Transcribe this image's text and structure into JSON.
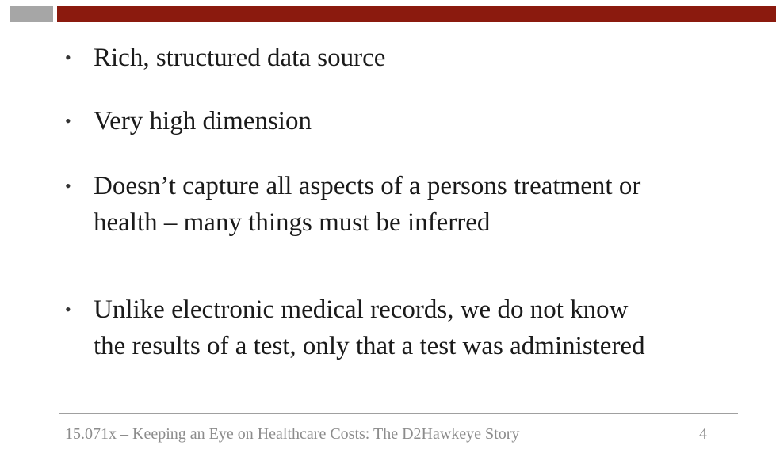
{
  "slide": {
    "bullets": [
      "Rich, structured data source",
      "Very high dimension",
      "Doesn’t capture all aspects of a persons treatment or\nhealth – many things must be inferred",
      "Unlike electronic medical records, we do not know\nthe results of a test, only that a test was administered"
    ],
    "bullet_marker": "•",
    "footer": "15.071x – Keeping an Eye on Healthcare Costs: The D2Hawkeye Story",
    "page_number": "4"
  },
  "colors": {
    "header_bar": "#8b1a0e",
    "header_block": "#a6a6a6",
    "footer_rule": "#a0a0a0",
    "footer_text": "#8c8c8c"
  }
}
